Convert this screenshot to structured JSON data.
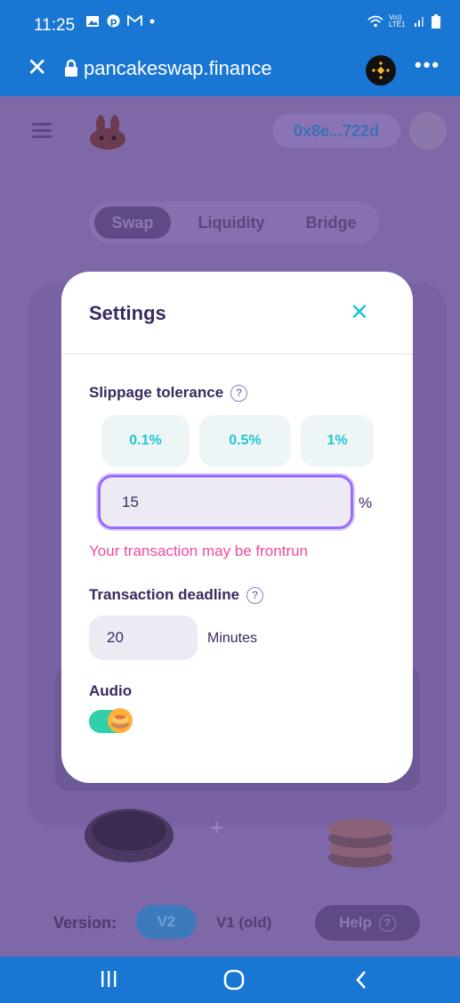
{
  "status_bar": {
    "time": "11:25",
    "network": "Vo)) LTE1"
  },
  "browser": {
    "url": "pancakeswap.finance"
  },
  "page": {
    "wallet_address": "0x8e...722d",
    "tabs": [
      {
        "label": "Swap",
        "active": true
      },
      {
        "label": "Liquidity",
        "active": false
      },
      {
        "label": "Bridge",
        "active": false
      }
    ],
    "version_label": "Version:",
    "version_v2": "V2",
    "version_v1": "V1 (old)",
    "help_label": "Help"
  },
  "settings": {
    "title": "Settings",
    "slippage_label": "Slippage tolerance",
    "slippage_options": [
      "0.1%",
      "0.5%",
      "1%"
    ],
    "slippage_value": "15",
    "slippage_unit": "%",
    "warning": "Your transaction may be frontrun",
    "deadline_label": "Transaction deadline",
    "deadline_value": "20",
    "deadline_unit": "Minutes",
    "audio_label": "Audio",
    "audio_enabled": true
  },
  "colors": {
    "accent": "#1FC7D4",
    "warning": "#ED4B9E",
    "text_primary": "#3A2A5E",
    "toggle_on": "#31D0AA",
    "input_focus": "#9A6AFF"
  }
}
